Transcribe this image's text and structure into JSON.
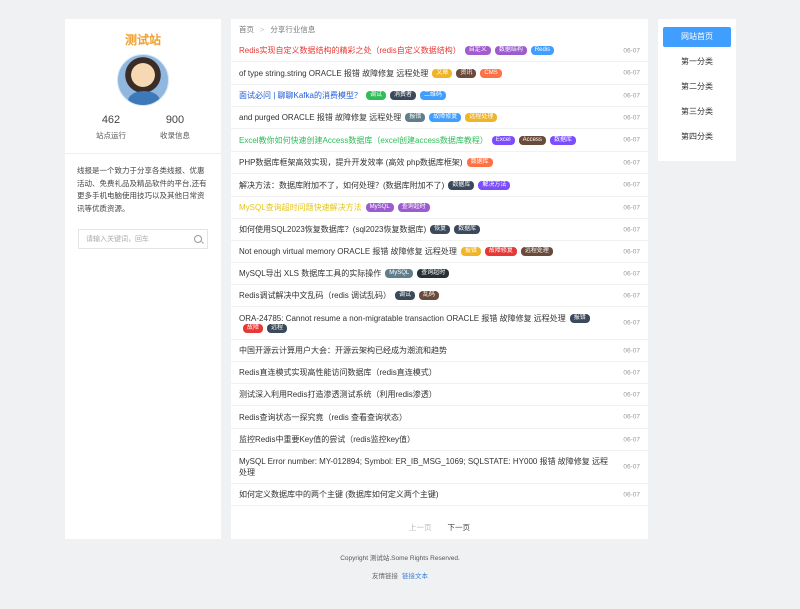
{
  "sidebar": {
    "site_name": "测试站",
    "stats": [
      {
        "num": "462",
        "label": "站点运行"
      },
      {
        "num": "900",
        "label": "收录信息"
      }
    ],
    "intro": "线报是一个致力于分享各类线报、优惠活动、免费礼品及精品软件的平台,还有更多手机电脑使用技巧以及其他日常资讯等优质资源。",
    "search_placeholder": "请输入关键词，回车"
  },
  "breadcrumb": {
    "home": "首页",
    "current": "分享行业信息"
  },
  "colors": {
    "accent": "#409eff"
  },
  "articles": [
    {
      "title": "Redis实现自定义数据结构的精彩之处（redis自定义数据结构）",
      "color": "#e53935",
      "date": "06-07",
      "tags": [
        {
          "t": "自定义",
          "c": "#a35bd0"
        },
        {
          "t": "数据结构",
          "c": "#9c5ccf"
        },
        {
          "t": "Redis",
          "c": "#409eff"
        }
      ]
    },
    {
      "title": "of type string.string ORACLE 报错 故障修复 远程处理",
      "color": "#333",
      "date": "06-07",
      "tags": [
        {
          "t": "文章",
          "c": "#f0b429"
        },
        {
          "t": "资讯",
          "c": "#6a4a3a"
        },
        {
          "t": "CMS",
          "c": "#ff7043"
        }
      ]
    },
    {
      "title": "面试必问 | 聊聊Kafka的消费模型？",
      "color": "#1e5bd8",
      "date": "06-07",
      "tags": [
        {
          "t": "调试",
          "c": "#2ebd59"
        },
        {
          "t": "消费者",
          "c": "#3b4a5a"
        },
        {
          "t": "二维码",
          "c": "#409eff"
        }
      ]
    },
    {
      "title": "and purged ORACLE 报错 故障修复 远程处理",
      "color": "#333",
      "date": "06-07",
      "tags": [
        {
          "t": "报错",
          "c": "#607d8b"
        },
        {
          "t": "故障修复",
          "c": "#409eff"
        },
        {
          "t": "远程处理",
          "c": "#f0b429"
        }
      ]
    },
    {
      "title": "Excel教你如何快速创建Access数据库（excel创建access数据库教程）",
      "color": "#2ebd59",
      "date": "06-07",
      "tags": [
        {
          "t": "Excel",
          "c": "#7c4dff"
        },
        {
          "t": "Access",
          "c": "#6a4a3a"
        },
        {
          "t": "数据库",
          "c": "#7c4dff"
        }
      ]
    },
    {
      "title": "PHP数据库框架高效实现，提升开发效率 (高效 php数据库框架)",
      "color": "#333",
      "date": "06-07",
      "tags": [
        {
          "t": "数据库",
          "c": "#ff7043"
        }
      ]
    },
    {
      "title": "解决方法：数据库附加不了，如何处理？(数据库附加不了)",
      "color": "#333",
      "date": "06-07",
      "tags": [
        {
          "t": "数据库",
          "c": "#3b4a5a"
        },
        {
          "t": "解决方法",
          "c": "#7c4dff"
        }
      ]
    },
    {
      "title": "MySQL查询超时问题快速解决方法",
      "color": "#e6c619",
      "date": "06-07",
      "tags": [
        {
          "t": "MySQL",
          "c": "#9c5ccf"
        },
        {
          "t": "查询超时",
          "c": "#9c5ccf"
        }
      ]
    },
    {
      "title": "如何使用SQL2023恢复数据库？(sql2023恢复数据库)",
      "color": "#333",
      "date": "06-07",
      "tags": [
        {
          "t": "恢复",
          "c": "#3b4a5a"
        },
        {
          "t": "数据库",
          "c": "#3b4a5a"
        }
      ]
    },
    {
      "title": "Not enough virtual memory ORACLE 报错 故障修复 远程处理",
      "color": "#333",
      "date": "06-07",
      "tags": [
        {
          "t": "报错",
          "c": "#f0b429"
        },
        {
          "t": "故障修复",
          "c": "#e53935"
        },
        {
          "t": "远程处理",
          "c": "#6a4a3a"
        }
      ]
    },
    {
      "title": "MySQL导出 XLS 数据库工具的实际操作",
      "color": "#333",
      "date": "06-07",
      "tags": [
        {
          "t": "MySQL",
          "c": "#607d8b"
        },
        {
          "t": "查询超时",
          "c": "#263238"
        }
      ]
    },
    {
      "title": "Redis调试解决中文乱码（redis 调试乱码）",
      "color": "#333",
      "date": "06-07",
      "tags": [
        {
          "t": "调试",
          "c": "#3b4a5a"
        },
        {
          "t": "乱码",
          "c": "#6a4a3a"
        }
      ]
    },
    {
      "title": "ORA-24785: Cannot resume a non-migratable transaction ORACLE 报错 故障修复 远程处理",
      "color": "#333",
      "date": "06-07",
      "tags": [
        {
          "t": "报错",
          "c": "#3b4a5a"
        },
        {
          "t": "故障",
          "c": "#e53935"
        },
        {
          "t": "远程",
          "c": "#3b4a5a"
        }
      ]
    },
    {
      "title": "中国开源云计算用户大会：开源云架构已经成为潮流和趋势",
      "color": "#333",
      "date": "06-07",
      "tags": []
    },
    {
      "title": "Redis直连模式实现高性能访问数据库（redis直连模式）",
      "color": "#333",
      "date": "06-07",
      "tags": []
    },
    {
      "title": "测试深入利用Redis打造渗透测试系统（利用redis渗透）",
      "color": "#333",
      "date": "06-07",
      "tags": []
    },
    {
      "title": "Redis查询状态一探究竟（redis 查看查询状态）",
      "color": "#333",
      "date": "06-07",
      "tags": []
    },
    {
      "title": "监控Redis中重要Key值的尝试（redis监控key值）",
      "color": "#333",
      "date": "06-07",
      "tags": []
    },
    {
      "title": "MySQL Error number: MY-012894; Symbol: ER_IB_MSG_1069; SQLSTATE: HY000 报错 故障修复 远程处理",
      "color": "#333",
      "date": "06-07",
      "tags": []
    },
    {
      "title": "如何定义数据库中的两个主键 (数据库如何定义两个主键)",
      "color": "#333",
      "date": "06-07",
      "tags": []
    }
  ],
  "pager": {
    "prev": "上一页",
    "next": "下一页"
  },
  "nav": [
    "网站首页",
    "第一分类",
    "第二分类",
    "第三分类",
    "第四分类"
  ],
  "footer": {
    "copyright": "Copyright 测试站.Some Rights Reserved.",
    "links_label": "友情链接",
    "link": "链接文本"
  }
}
